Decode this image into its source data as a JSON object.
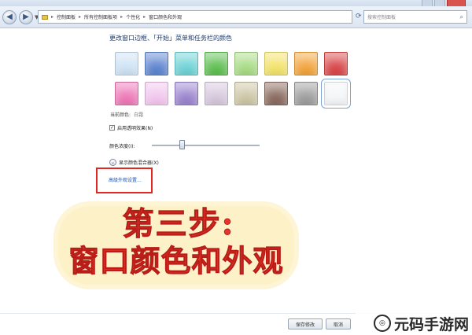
{
  "navbar": {
    "back_icon": "back-arrow-icon",
    "forward_icon": "forward-arrow-icon",
    "breadcrumb": [
      "控制面板",
      "所有控制面板项",
      "个性化",
      "窗口颜色和外观"
    ],
    "search_placeholder": "搜索控制面板"
  },
  "main": {
    "heading": "更改窗口边框、「开始」菜单和任务栏的颜色",
    "swatches": [
      {
        "color": "#cfe3f5",
        "selected": false
      },
      {
        "color": "#5f86d1",
        "selected": false
      },
      {
        "color": "#6fd3d6",
        "selected": false
      },
      {
        "color": "#5fbf52",
        "selected": false
      },
      {
        "color": "#a9dc86",
        "selected": false
      },
      {
        "color": "#f3e36b",
        "selected": false
      },
      {
        "color": "#f3a53d",
        "selected": false
      },
      {
        "color": "#d9484a",
        "selected": false
      },
      {
        "color": "#ee79b8",
        "selected": false
      },
      {
        "color": "#f2c6ee",
        "selected": false
      },
      {
        "color": "#9b85cf",
        "selected": false
      },
      {
        "color": "#d6c8dd",
        "selected": false
      },
      {
        "color": "#cdc6a6",
        "selected": false
      },
      {
        "color": "#8a6b60",
        "selected": false
      },
      {
        "color": "#9e9e9e",
        "selected": false
      },
      {
        "color": "#f4f6f9",
        "selected": true
      }
    ],
    "current_color_label": "当前颜色:",
    "current_color_value": "白霜",
    "transparency_label": "启用透明效果(N)",
    "transparency_checked": "✓",
    "intensity_label": "颜色浓度(I):",
    "intensity_value": 0.28,
    "mixer_label": "显示颜色混合器(X)",
    "advanced_link": "高级外观设置..."
  },
  "banner": {
    "line1": "第三步:",
    "line2": "窗口颜色和外观"
  },
  "footer": {
    "save_label": "保存修改",
    "cancel_label": "取消"
  },
  "watermark": {
    "text": "元码手游网"
  }
}
